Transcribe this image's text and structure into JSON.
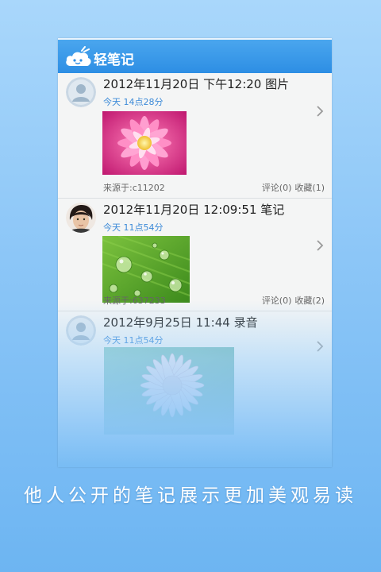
{
  "app": {
    "title": "轻笔记",
    "brand_color": "#2d8ee4"
  },
  "notes": [
    {
      "title": "2012年11月20日 下午12:20 图片",
      "time": "今天 14点28分",
      "source": "来源于:c11202",
      "comments": "评论(0)",
      "favorites": "收藏(1)",
      "avatar": "default-avatar",
      "image": "pink-flower"
    },
    {
      "title": "2012年11月20日 12:09:51 笔记",
      "time": "今天 11点54分",
      "source": "来源于:637233",
      "comments": "评论(0)",
      "favorites": "收藏(2)",
      "avatar": "user-photo",
      "image": "green-water-drops"
    },
    {
      "title": "2012年9月25日  11:44 录音",
      "time": "今天 11点54分",
      "avatar": "default-avatar",
      "image": "white-flower"
    }
  ],
  "caption": "他人公开的笔记展示更加美观易读"
}
